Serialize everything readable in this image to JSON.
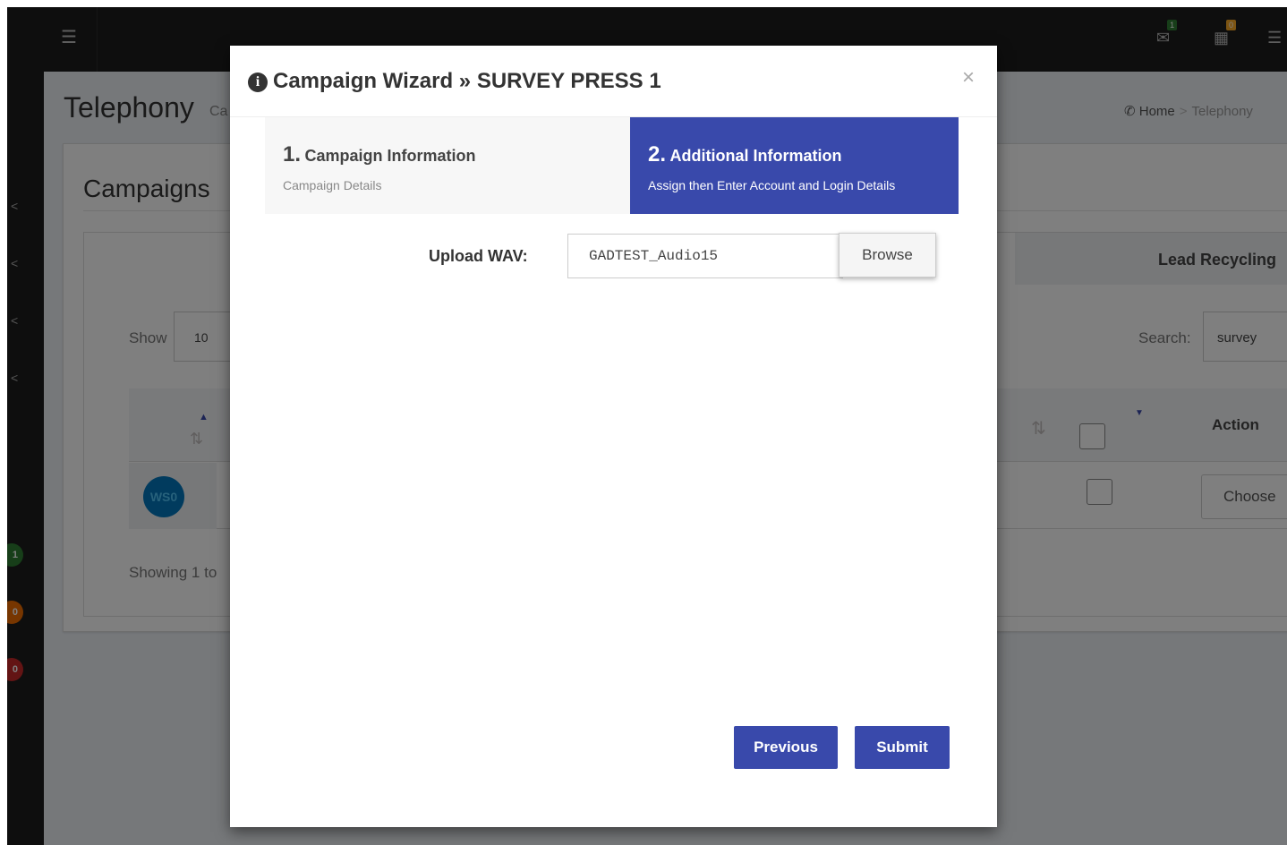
{
  "topbar": {
    "menu_icon": "hamburger-icon",
    "mail_badge": "1",
    "calendar_badge": "0"
  },
  "sidebar": {
    "badges": [
      "1",
      "0",
      "0"
    ]
  },
  "page": {
    "title": "Telephony",
    "subtitle_fragment": "Ca",
    "breadcrumb": {
      "home": "Home",
      "separator": ">",
      "current": "Telephony"
    }
  },
  "panel": {
    "title": "Campaigns",
    "tab_lead_recycling": "Lead Recycling",
    "show_label": "Show",
    "show_value": "10",
    "search_label": "Search:",
    "search_value": "survey",
    "action_header": "Action",
    "row_avatar": "WS0",
    "choose_label": "Choose",
    "showing_text": "Showing 1 to"
  },
  "modal": {
    "title": "Campaign Wizard » SURVEY PRESS 1",
    "close_label": "×",
    "steps": [
      {
        "num": "1.",
        "title": "Campaign Information",
        "desc": "Campaign Details",
        "active": false
      },
      {
        "num": "2.",
        "title": "Additional Information",
        "desc": "Assign then Enter Account and Login Details",
        "active": true
      }
    ],
    "upload_label": "Upload WAV:",
    "upload_value": "GADTEST_Audio15",
    "browse_label": "Browse",
    "previous_label": "Previous",
    "submit_label": "Submit"
  },
  "colors": {
    "primary": "#3949ab",
    "topbar": "#1c1c1c",
    "badge_green": "#2e7d32",
    "badge_orange": "#ef6c00",
    "badge_red": "#c62828"
  }
}
